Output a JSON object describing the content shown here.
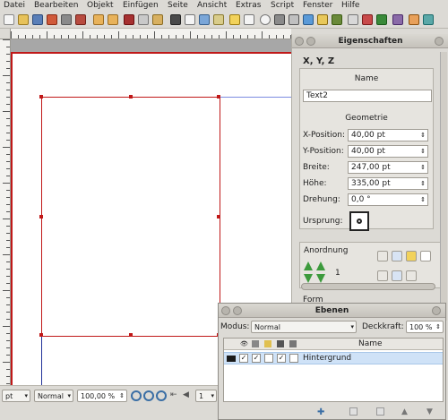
{
  "menubar": {
    "items": [
      "Datei",
      "Bearbeiten",
      "Objekt",
      "Einfügen",
      "Seite",
      "Ansicht",
      "Extras",
      "Script",
      "Fenster",
      "Hilfe"
    ]
  },
  "statusbar": {
    "unit": "pt",
    "mode": "Normal",
    "zoom": "100,00 %",
    "page": "1"
  },
  "properties": {
    "title": "Eigenschaften",
    "section_xyz": "X, Y, Z",
    "name_label": "Name",
    "name_value": "Text2",
    "geometry_label": "Geometrie",
    "x_label": "X-Position:",
    "x_value": "40,00 pt",
    "y_label": "Y-Position:",
    "y_value": "40,00 pt",
    "width_label": "Breite:",
    "width_value": "247,00 pt",
    "height_label": "Höhe:",
    "height_value": "335,00 pt",
    "rotation_label": "Drehung:",
    "rotation_value": "0,0 °",
    "origin_label": "Ursprung:",
    "arrangement_label": "Anordnung",
    "arrangement_value": "1",
    "form_label": "Form"
  },
  "layers": {
    "title": "Ebenen",
    "mode_label": "Modus:",
    "mode_value": "Normal",
    "opacity_label": "Deckkraft:",
    "opacity_value": "100 %",
    "name_column": "Name",
    "rows": [
      {
        "name": "Hintergrund",
        "color": "#1a1a1a"
      }
    ]
  },
  "colors": {
    "selection": "#c01818",
    "guide": "#7c8be0",
    "layer_row": "#cfe2f7"
  }
}
